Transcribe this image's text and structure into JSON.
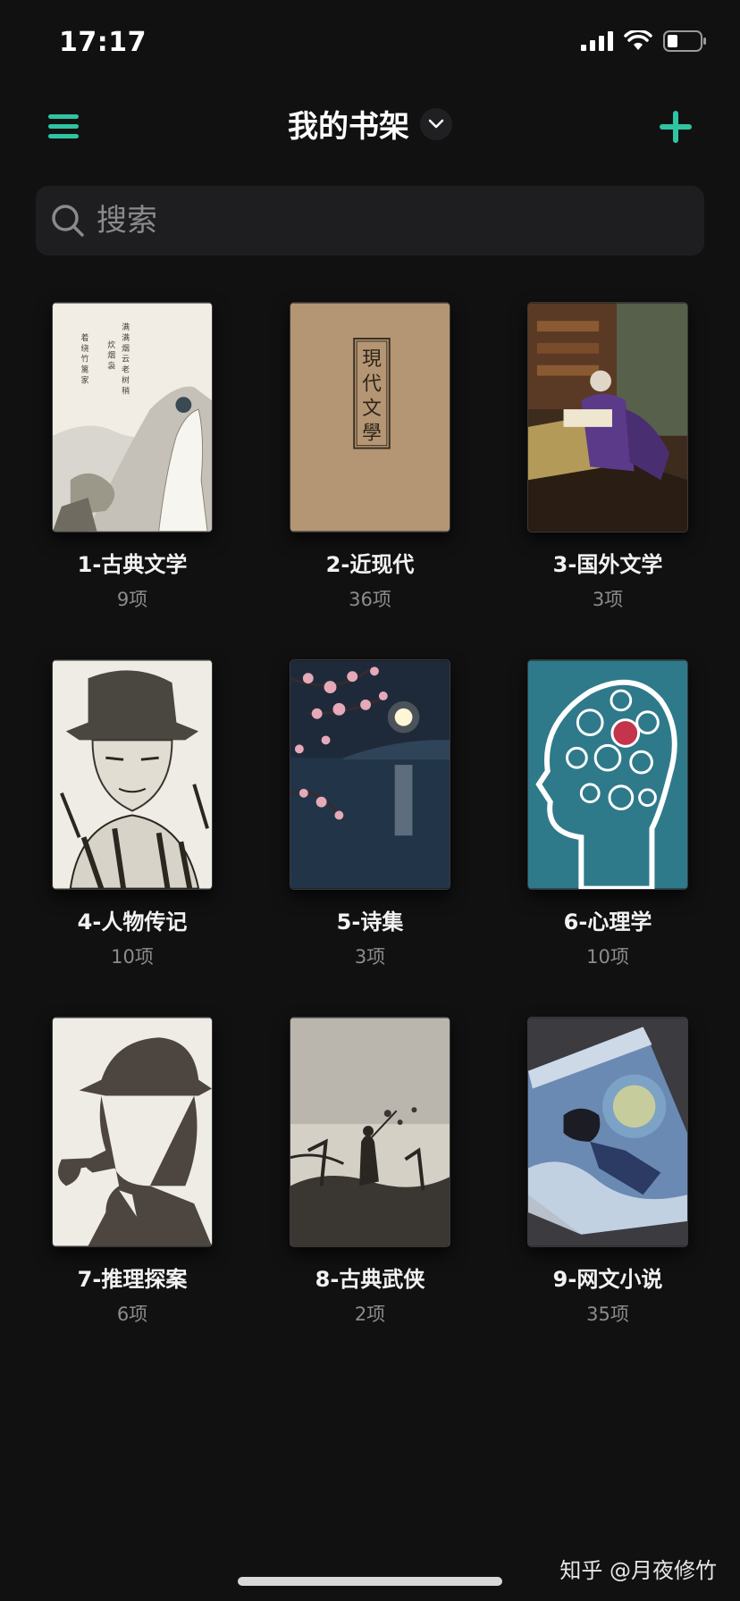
{
  "status": {
    "time": "17:17"
  },
  "header": {
    "title": "我的书架"
  },
  "search": {
    "placeholder": "搜索"
  },
  "books": [
    {
      "title": "1-古典文学",
      "count": "9项",
      "cover_text": "满满烟云老树稍 炊烟袅 着绕竹篱家"
    },
    {
      "title": "2-近现代",
      "count": "36项",
      "cover_text": "現代文學"
    },
    {
      "title": "3-国外文学",
      "count": "3项"
    },
    {
      "title": "4-人物传记",
      "count": "10项"
    },
    {
      "title": "5-诗集",
      "count": "3项"
    },
    {
      "title": "6-心理学",
      "count": "10项"
    },
    {
      "title": "7-推理探案",
      "count": "6项"
    },
    {
      "title": "8-古典武侠",
      "count": "2项"
    },
    {
      "title": "9-网文小说",
      "count": "35项"
    }
  ],
  "watermark": "知乎 @月夜修竹",
  "colors": {
    "accent": "#2fc4a2",
    "background": "#111112",
    "search_bg": "#1e1e20"
  },
  "icons": [
    "signal-icon",
    "wifi-icon",
    "battery-icon",
    "menu-icon",
    "chevron-down-icon",
    "plus-icon",
    "search-icon"
  ]
}
